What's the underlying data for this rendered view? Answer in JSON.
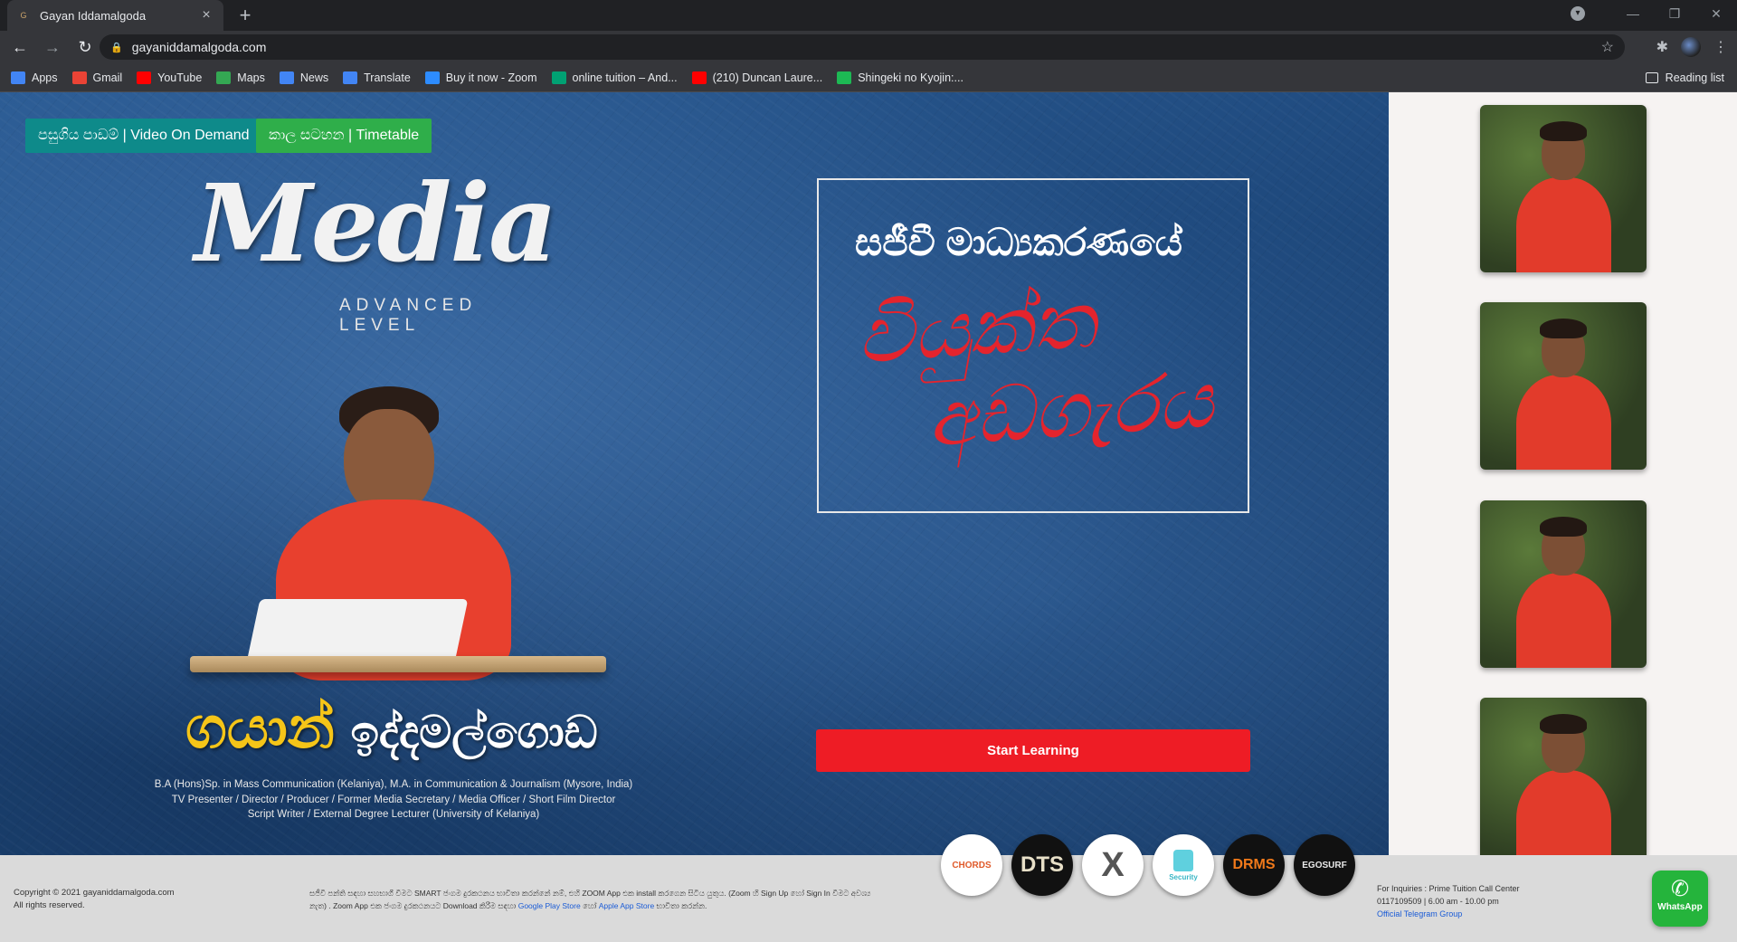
{
  "browser": {
    "tab_title": "Gayan Iddamalgoda",
    "url": "gayaniddamalgoda.com",
    "bookmarks": [
      {
        "label": "Apps",
        "icon": "apps-grid-icon",
        "color": "#4285f4"
      },
      {
        "label": "Gmail",
        "icon": "gmail-icon",
        "color": "#ea4335"
      },
      {
        "label": "YouTube",
        "icon": "youtube-icon",
        "color": "#ff0000"
      },
      {
        "label": "Maps",
        "icon": "maps-pin-icon",
        "color": "#34a853"
      },
      {
        "label": "News",
        "icon": "news-icon",
        "color": "#4285f4"
      },
      {
        "label": "Translate",
        "icon": "translate-icon",
        "color": "#4285f4"
      },
      {
        "label": "Buy it now - Zoom",
        "icon": "zoom-icon",
        "color": "#2d8cff"
      },
      {
        "label": "online tuition – And...",
        "icon": "play-store-icon",
        "color": "#00a173"
      },
      {
        "label": "(210) Duncan Laure...",
        "icon": "youtube-icon",
        "color": "#ff0000"
      },
      {
        "label": "Shingeki no Kyojin:...",
        "icon": "tv-icon",
        "color": "#1db954"
      }
    ],
    "reading_list": "Reading list"
  },
  "hero": {
    "btn_vod": "පසුගිය පාඩම් | Video On Demand",
    "btn_timetable": "කාල සටහන | Timetable",
    "media_word": "Media",
    "media_sub": "ADVANCED LEVEL",
    "name_first": "ගයාන්",
    "name_last": "ඉද්දමල්ගොඩ",
    "qual_1": "B.A (Hons)Sp. in Mass Communication (Kelaniya), M.A. in Communication & Journalism (Mysore, India)",
    "qual_2": "TV Presenter / Director / Producer / Former Media Secretary / Media Officer / Short Film Director",
    "qual_3": "Script Writer / External Degree Lecturer (University of Kelaniya)",
    "showcase_line1": "සජීවී මාධ්‍යකරණයේ",
    "showcase_line2": "වියුක්ත",
    "showcase_line3": "අඩගැරය",
    "start_button": "Start Learning"
  },
  "footer": {
    "copyright": "Copyright © 2021 gayaniddamalgoda.com",
    "rights": "All rights reserved.",
    "note_text": "සජීවී පන්ති සඳහා සහභාගී වීමට SMART ජංගම දුරකථනය භාවිතා කරන්නේ නම්, එහි ZOOM App එක install කරගෙන සිටිය යුතුය. (Zoom හි Sign Up හෝ Sign In වීමට අවශ්‍ය නැත) . Zoom App එක ජංගම දුරකථනයට Download කිරීම සඳහා",
    "google_play": "Google Play Store",
    "note_or": "හෝ",
    "app_store": "Apple App Store",
    "note_end": "භාවිතා කරන්න.",
    "inquiries": "For Inquiries : Prime Tuition Call Center",
    "phone": "0117109509 | 6.00 am - 10.00 pm",
    "telegram": "Official Telegram Group"
  },
  "partners": [
    {
      "name": "chords-logo",
      "label": "CHORDS"
    },
    {
      "name": "dts-logo",
      "label": "DTS"
    },
    {
      "name": "x-logo",
      "label": "X"
    },
    {
      "name": "security-logo",
      "label": "Security"
    },
    {
      "name": "drms-logo",
      "label": "DRMS"
    },
    {
      "name": "egosurf-logo",
      "label": "EGOSURF"
    }
  ],
  "whatsapp": {
    "label": "WhatsApp"
  }
}
